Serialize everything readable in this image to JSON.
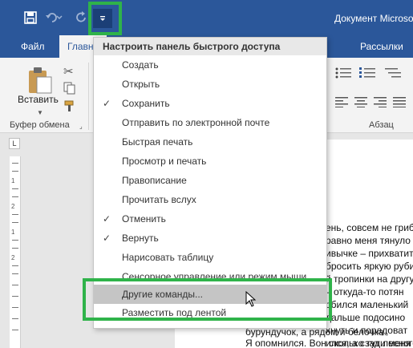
{
  "titlebar": {
    "doc_title": "Документ Microso",
    "qat_icons": [
      "save-icon",
      "undo-icon",
      "redo-icon",
      "customize-qat-icon"
    ]
  },
  "tabs": [
    {
      "label": "Файл"
    },
    {
      "label": "Главна"
    },
    {
      "label": "Рассылки"
    }
  ],
  "ribbon": {
    "paste_label": "Вставить",
    "groups": {
      "clipboard": "Буфер обмена",
      "paragraph": "Абзац"
    }
  },
  "menu": {
    "header": "Настроить панель быстрого доступа",
    "items": [
      {
        "label": "Создать",
        "checked": false
      },
      {
        "label": "Открыть",
        "checked": false
      },
      {
        "label": "Сохранить",
        "checked": true
      },
      {
        "label": "Отправить по электронной почте",
        "checked": false
      },
      {
        "label": "Быстрая печать",
        "checked": false
      },
      {
        "label": "Просмотр и печать",
        "checked": false
      },
      {
        "label": "Правописание",
        "checked": false
      },
      {
        "label": "Прочитать вслух",
        "checked": false
      },
      {
        "label": "Отменить",
        "checked": true
      },
      {
        "label": "Вернуть",
        "checked": true
      },
      {
        "label": "Нарисовать таблицу",
        "checked": false
      },
      {
        "label": "Сенсорное управление или режим мыши",
        "checked": false
      },
      {
        "label": "Другие команды...",
        "checked": false
      },
      {
        "label": "Разместить под лентой",
        "checked": false
      }
    ],
    "check_glyph": "✓"
  },
  "document": {
    "lines": [
      "ень, совсем не гриб",
      "равно меня тянуло н",
      "ивычке – прихватит",
      "бросить яркую руби",
      "й тропинки на другу",
      "– откуда-то потян",
      "обился маленький",
      "дальше подосино",
      "хнуть и порадоват",
      "ился, а сзади меня зв",
      "бурундучок, а рядом и белочка.",
      "Я опомнился. Вон сколько тут лесного н"
    ]
  },
  "ruler": {
    "corner": "L",
    "numbers": [
      "1",
      "2",
      "1",
      "2"
    ]
  },
  "colors": {
    "titlebar": "#2b579a",
    "highlight": "#2fb34a"
  }
}
